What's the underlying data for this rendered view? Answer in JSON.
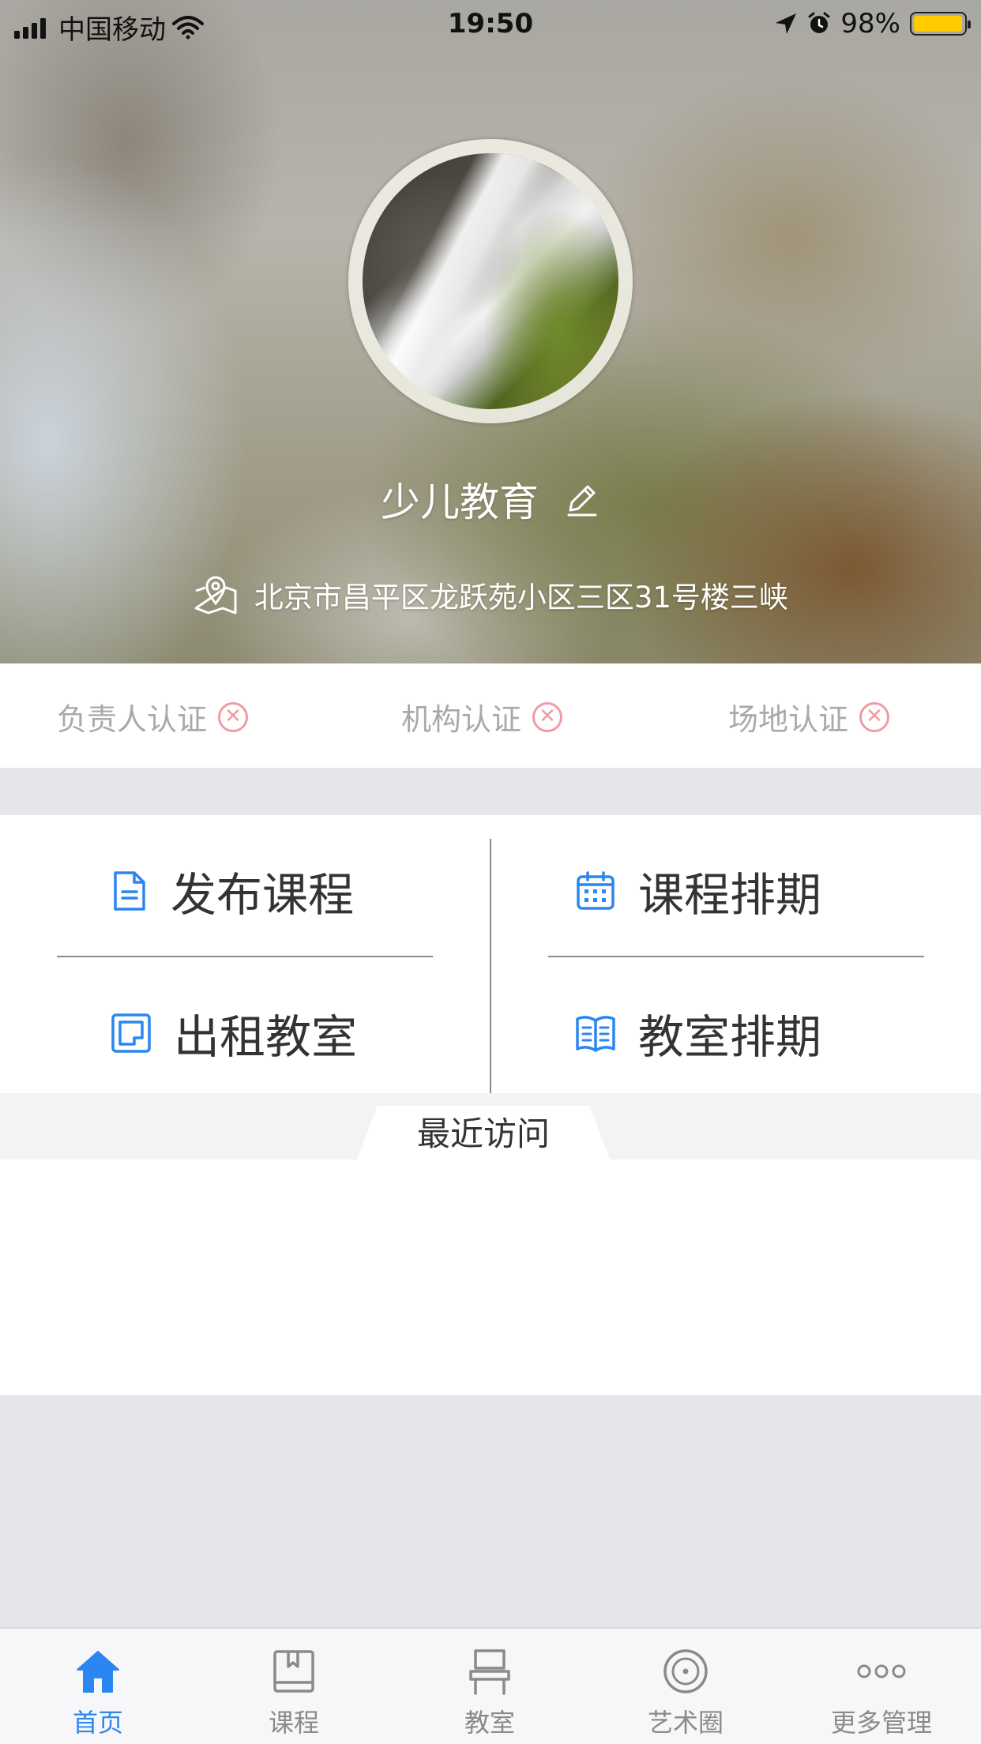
{
  "status_bar": {
    "carrier": "中国移动",
    "time": "19:50",
    "battery_percent": "98%",
    "battery_color": "#ffcc00"
  },
  "profile": {
    "org_name": "少儿教育",
    "address": "北京市昌平区龙跃苑小区三区31号楼三峡"
  },
  "certifications": [
    {
      "label": "负责人认证",
      "icon": "cross-circle-icon"
    },
    {
      "label": "机构认证",
      "icon": "cross-circle-icon"
    },
    {
      "label": "场地认证",
      "icon": "cross-circle-icon"
    }
  ],
  "actions": {
    "publish_course": {
      "label": "发布课程",
      "icon": "document-icon"
    },
    "course_schedule": {
      "label": "课程排期",
      "icon": "calendar-icon"
    },
    "rent_classroom": {
      "label": "出租教室",
      "icon": "monitor-icon"
    },
    "classroom_schedule": {
      "label": "教室排期",
      "icon": "book-icon"
    }
  },
  "recent": {
    "title": "最近访问"
  },
  "tabbar": {
    "items": [
      {
        "label": "首页",
        "icon": "home-icon",
        "active": true
      },
      {
        "label": "课程",
        "icon": "book-icon",
        "active": false
      },
      {
        "label": "教室",
        "icon": "chair-icon",
        "active": false
      },
      {
        "label": "艺术圈",
        "icon": "disc-icon",
        "active": false
      },
      {
        "label": "更多管理",
        "icon": "more-icon",
        "active": false
      }
    ]
  },
  "colors": {
    "accent": "#2a86f0",
    "cert_error": "#f19aa3",
    "text_primary": "#333333",
    "text_muted": "#a9a9a9"
  }
}
